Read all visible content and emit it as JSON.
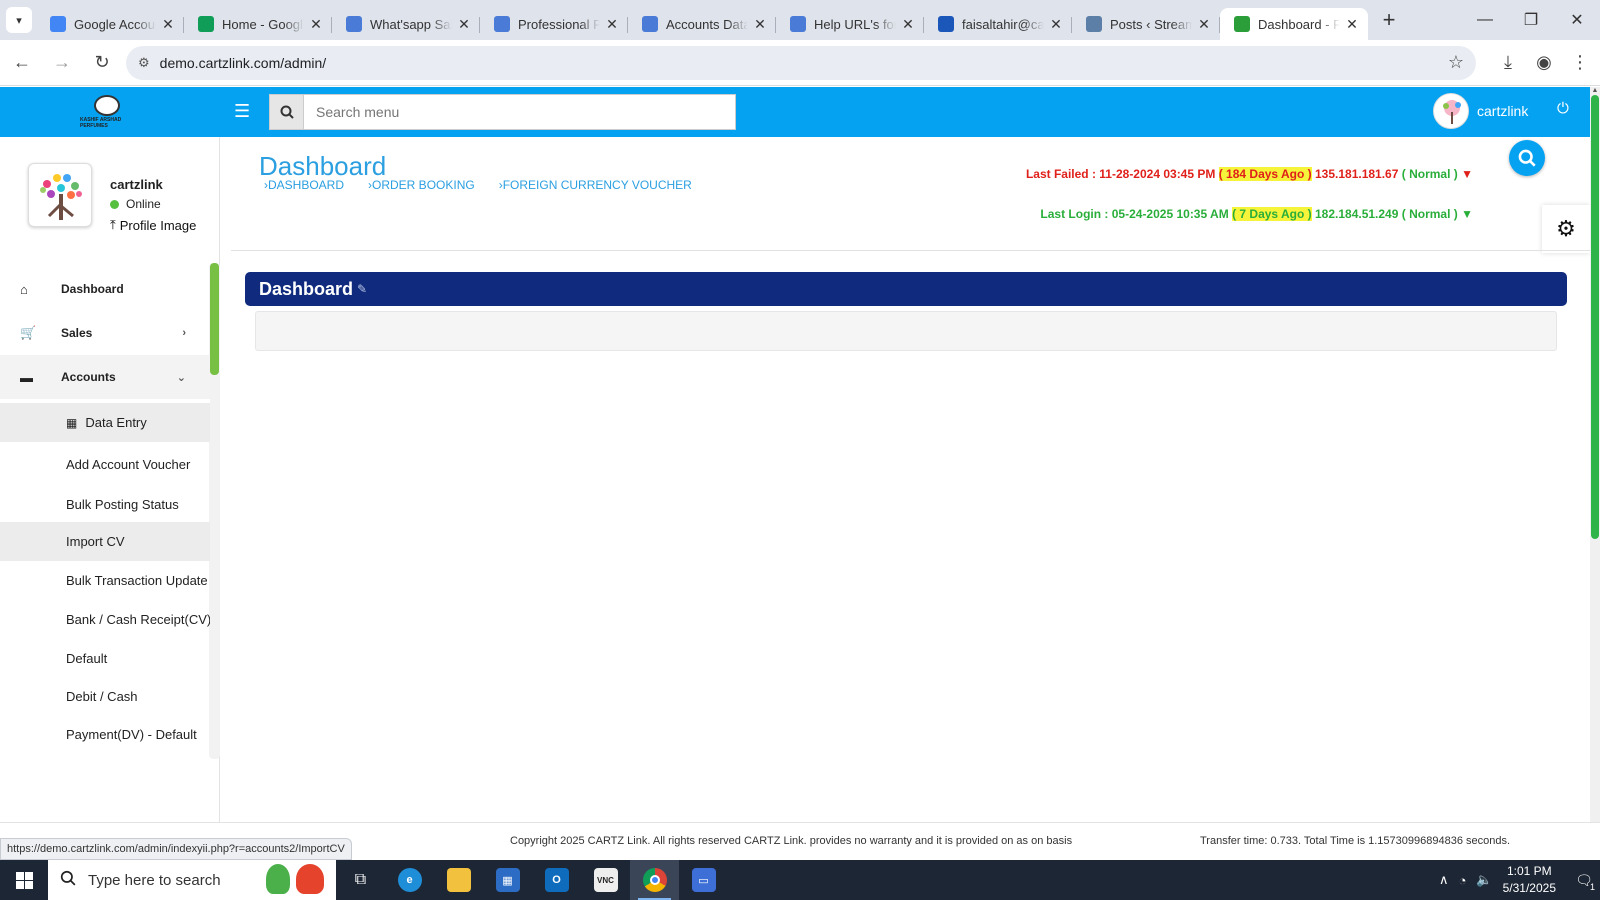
{
  "browser": {
    "tabs": [
      {
        "title": "Google Account",
        "favicon": "google-icon",
        "color": "#4285f4"
      },
      {
        "title": "Home - Google Drive",
        "favicon": "drive-icon",
        "color": "#0f9d58"
      },
      {
        "title": "What'sapp Sales",
        "favicon": "docs-icon",
        "color": "#4a7bd6"
      },
      {
        "title": "Professional Profile",
        "favicon": "docs-icon",
        "color": "#4a7bd6"
      },
      {
        "title": "Accounts Data",
        "favicon": "docs-icon",
        "color": "#4a7bd6"
      },
      {
        "title": "Help URL's for",
        "favicon": "docs-icon",
        "color": "#4a7bd6"
      },
      {
        "title": "faisaltahir@cartzlink",
        "favicon": "mail-icon",
        "color": "#1a57b8"
      },
      {
        "title": "Posts ‹ Streamline",
        "favicon": "wordpress-icon",
        "color": "#5b7fa6"
      },
      {
        "title": "Dashboard - Pos",
        "favicon": "cartz-icon",
        "color": "#2b9e3a"
      }
    ],
    "active_tab_index": 8,
    "url": "demo.cartzlink.com/admin/"
  },
  "header": {
    "search_placeholder": "Search menu",
    "username": "cartzlink",
    "logo_text": "KASHIF ARSHAD PERFUMES"
  },
  "sidebar": {
    "profile_name": "cartzlink",
    "status": "Online",
    "profile_image_label": "Profile Image",
    "menu": [
      {
        "label": "Dashboard",
        "icon": "home-icon"
      },
      {
        "label": "Sales",
        "icon": "cart-icon"
      },
      {
        "label": "Accounts",
        "icon": "briefcase-icon"
      }
    ],
    "submenu": [
      {
        "label": "Data Entry"
      },
      {
        "label": "Add Account Voucher"
      },
      {
        "label": "Bulk Posting Status"
      },
      {
        "label": "Import CV"
      },
      {
        "label": "Bulk Transaction Update"
      },
      {
        "label": "Bank / Cash Receipt(CV) -"
      },
      {
        "label": "Default"
      },
      {
        "label": "Debit / Cash"
      },
      {
        "label": "Payment(DV) - Default"
      }
    ]
  },
  "main": {
    "page_title": "Dashboard",
    "breadcrumbs": [
      "DASHBOARD",
      "ORDER BOOKING",
      "FOREIGN CURRENCY VOUCHER"
    ],
    "last_failed": {
      "label": "Last Failed : 11-28-2024 03:45 PM",
      "ago": "( 184 Days Ago )",
      "ip": "135.181.181.67",
      "status": "( Normal )"
    },
    "last_login": {
      "label": "Last Login : 05-24-2025 10:35 AM",
      "ago": "( 7 Days Ago )",
      "ip": "182.184.51.249",
      "status": "( Normal )"
    },
    "panel_title": "Dashboard"
  },
  "footer": {
    "copyright": "Copyright 2025 CARTZ Link. All rights reserved CARTZ Link. provides no warranty and it is provided on as on basis",
    "transfer": "Transfer time: 0.733. Total Time is 1.15730996894836 seconds.",
    "status_url": "https://demo.cartzlink.com/admin/indexyii.php?r=accounts2/ImportCV"
  },
  "taskbar": {
    "search_placeholder": "Type here to search",
    "time": "1:01 PM",
    "date": "5/31/2025",
    "notification_count": "1"
  },
  "colors": {
    "header_blue": "#05a2f2",
    "panel_navy": "#102b7e",
    "failed_red": "#e0201a",
    "login_green": "#2aae3a",
    "highlight_yellow": "#f5f33a"
  }
}
